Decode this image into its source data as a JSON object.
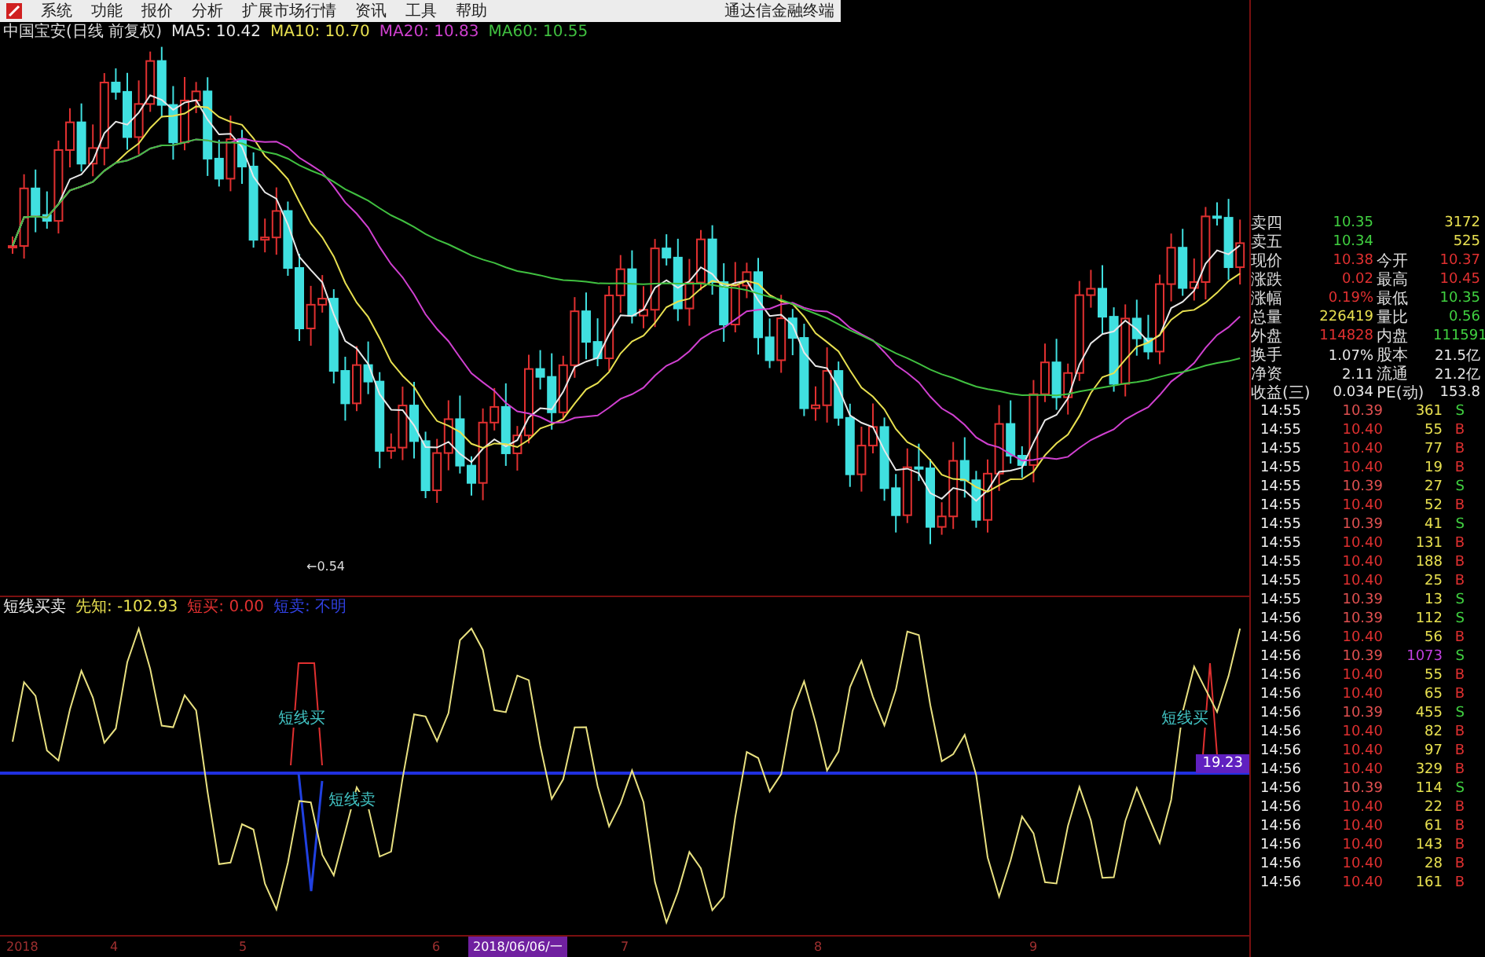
{
  "menu": [
    {
      "label": "系统"
    },
    {
      "label": "功能"
    },
    {
      "label": "报价"
    },
    {
      "label": "分析"
    },
    {
      "label": "扩展市场行情"
    },
    {
      "label": "资讯"
    },
    {
      "label": "工具"
    },
    {
      "label": "帮助"
    }
  ],
  "app_title": "通达信金融终端",
  "chart_title": "中国宝安(日线 前复权)",
  "ma_labels": [
    {
      "text": "MA5: 10.42",
      "color": "#e8e8e8"
    },
    {
      "text": "MA10: 10.70",
      "color": "#e8e050"
    },
    {
      "text": "MA20: 10.83",
      "color": "#d040d0"
    },
    {
      "text": "MA60: 10.55",
      "color": "#40c040"
    }
  ],
  "low_label": "←0.54",
  "indicator_header": [
    {
      "text": "短线买卖",
      "color": "#e8e8e8"
    },
    {
      "text": "先知: -102.93",
      "color": "#e8e050"
    },
    {
      "text": "短买: 0.00",
      "color": "#e03030"
    },
    {
      "text": "短卖: 不明",
      "color": "#3040e0"
    }
  ],
  "signal_labels": [
    {
      "text": "短线买",
      "kind": "buy"
    },
    {
      "text": "短线卖",
      "kind": "sell"
    },
    {
      "text": "短线买",
      "kind": "buy"
    }
  ],
  "indicator_tag": "19.23",
  "axis": {
    "labels": [
      "2018",
      "4",
      "5",
      "6",
      "7",
      "8",
      "9"
    ],
    "current_date": "2018/06/06/一"
  },
  "quotes": [
    {
      "label": "卖四",
      "value": {
        "text": "10.35",
        "color": "#40d040"
      },
      "value2": {
        "text": "3172",
        "color": "#e8e050"
      }
    },
    {
      "label": "卖五",
      "value": {
        "text": "10.34",
        "color": "#40d040"
      },
      "value2": {
        "text": "525",
        "color": "#e8e050"
      }
    },
    {
      "label": "现价",
      "value": {
        "text": "10.38",
        "color": "#e03030"
      },
      "label2": "今开",
      "value2": {
        "text": "10.37",
        "color": "#e03030"
      }
    },
    {
      "label": "涨跌",
      "value": {
        "text": "0.02",
        "color": "#e03030"
      },
      "label2": "最高",
      "value2": {
        "text": "10.45",
        "color": "#e03030"
      }
    },
    {
      "label": "涨幅",
      "value": {
        "text": "0.19%",
        "color": "#e03030"
      },
      "label2": "最低",
      "value2": {
        "text": "10.35",
        "color": "#40d040"
      }
    },
    {
      "label": "总量",
      "value": {
        "text": "226419",
        "color": "#e8e050"
      },
      "label2": "量比",
      "value2": {
        "text": "0.56",
        "color": "#40d040"
      }
    },
    {
      "label": "外盘",
      "value": {
        "text": "114828",
        "color": "#e03030"
      },
      "label2": "内盘",
      "value2": {
        "text": "111591",
        "color": "#40d040"
      }
    },
    {
      "label": "换手",
      "value": {
        "text": "1.07%",
        "color": "#e8e8e8"
      },
      "label2": "股本",
      "value2": {
        "text": "21.5亿",
        "color": "#e8e8e8"
      }
    },
    {
      "label": "净资",
      "value": {
        "text": "2.11",
        "color": "#e8e8e8"
      },
      "label2": "流通",
      "value2": {
        "text": "21.2亿",
        "color": "#e8e8e8"
      }
    },
    {
      "label": "收益(三)",
      "value": {
        "text": "0.034",
        "color": "#e8e8e8"
      },
      "label2": "PE(动)",
      "value2": {
        "text": "153.8",
        "color": "#e8e8e8"
      }
    }
  ],
  "ticks": [
    {
      "time": "14:55",
      "price": "10.39",
      "volume": "361",
      "side": "S",
      "large": false
    },
    {
      "time": "14:55",
      "price": "10.40",
      "volume": "55",
      "side": "B",
      "large": false
    },
    {
      "time": "14:55",
      "price": "10.40",
      "volume": "77",
      "side": "B",
      "large": false
    },
    {
      "time": "14:55",
      "price": "10.40",
      "volume": "19",
      "side": "B",
      "large": false
    },
    {
      "time": "14:55",
      "price": "10.39",
      "volume": "27",
      "side": "S",
      "large": false
    },
    {
      "time": "14:55",
      "price": "10.40",
      "volume": "52",
      "side": "B",
      "large": false
    },
    {
      "time": "14:55",
      "price": "10.39",
      "volume": "41",
      "side": "S",
      "large": false
    },
    {
      "time": "14:55",
      "price": "10.40",
      "volume": "131",
      "side": "B",
      "large": false
    },
    {
      "time": "14:55",
      "price": "10.40",
      "volume": "188",
      "side": "B",
      "large": false
    },
    {
      "time": "14:55",
      "price": "10.40",
      "volume": "25",
      "side": "B",
      "large": false
    },
    {
      "time": "14:55",
      "price": "10.39",
      "volume": "13",
      "side": "S",
      "large": false
    },
    {
      "time": "14:56",
      "price": "10.39",
      "volume": "112",
      "side": "S",
      "large": false
    },
    {
      "time": "14:56",
      "price": "10.40",
      "volume": "56",
      "side": "B",
      "large": false
    },
    {
      "time": "14:56",
      "price": "10.39",
      "volume": "1073",
      "side": "S",
      "large": true
    },
    {
      "time": "14:56",
      "price": "10.40",
      "volume": "55",
      "side": "B",
      "large": false
    },
    {
      "time": "14:56",
      "price": "10.40",
      "volume": "65",
      "side": "B",
      "large": false
    },
    {
      "time": "14:56",
      "price": "10.39",
      "volume": "455",
      "side": "S",
      "large": false
    },
    {
      "time": "14:56",
      "price": "10.40",
      "volume": "82",
      "side": "B",
      "large": false
    },
    {
      "time": "14:56",
      "price": "10.40",
      "volume": "97",
      "side": "B",
      "large": false
    },
    {
      "time": "14:56",
      "price": "10.40",
      "volume": "329",
      "side": "B",
      "large": false
    },
    {
      "time": "14:56",
      "price": "10.39",
      "volume": "114",
      "side": "S",
      "large": false
    },
    {
      "time": "14:56",
      "price": "10.40",
      "volume": "22",
      "side": "B",
      "large": false
    },
    {
      "time": "14:56",
      "price": "10.40",
      "volume": "61",
      "side": "B",
      "large": false
    },
    {
      "time": "14:56",
      "price": "10.40",
      "volume": "143",
      "side": "B",
      "large": false
    },
    {
      "time": "14:56",
      "price": "10.40",
      "volume": "28",
      "side": "B",
      "large": false
    },
    {
      "time": "14:56",
      "price": "10.40",
      "volume": "161",
      "side": "B",
      "large": false
    }
  ]
}
